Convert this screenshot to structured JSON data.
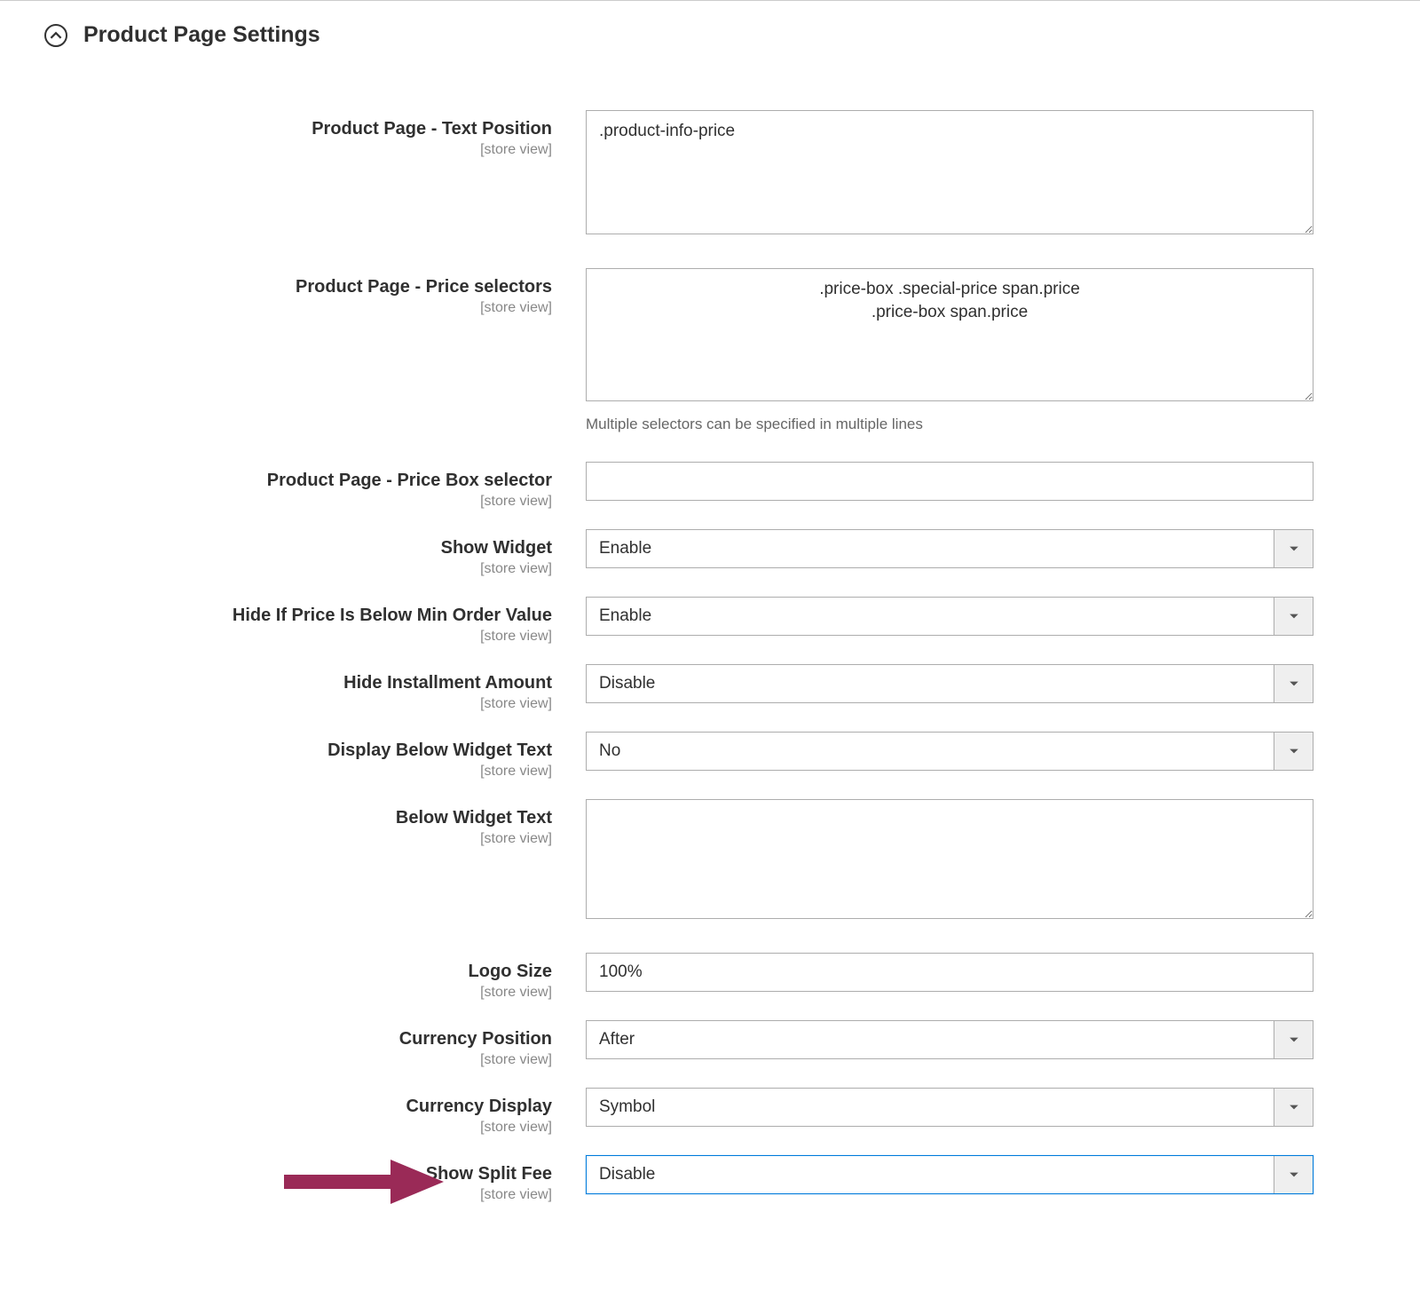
{
  "section": {
    "title": "Product Page Settings"
  },
  "fields": {
    "text_position": {
      "label": "Product Page - Text Position",
      "scope": "[store view]",
      "value": ".product-info-price"
    },
    "price_selectors": {
      "label": "Product Page - Price selectors",
      "scope": "[store view]",
      "value": ".price-box .special-price span.price\n.price-box span.price",
      "note": "Multiple selectors can be specified in multiple lines"
    },
    "price_box_selector": {
      "label": "Product Page - Price Box selector",
      "scope": "[store view]",
      "value": ""
    },
    "show_widget": {
      "label": "Show Widget",
      "scope": "[store view]",
      "value": "Enable"
    },
    "hide_below_min": {
      "label": "Hide If Price Is Below Min Order Value",
      "scope": "[store view]",
      "value": "Enable"
    },
    "hide_installment": {
      "label": "Hide Installment Amount",
      "scope": "[store view]",
      "value": "Disable"
    },
    "display_below_widget_text": {
      "label": "Display Below Widget Text",
      "scope": "[store view]",
      "value": "No"
    },
    "below_widget_text": {
      "label": "Below Widget Text",
      "scope": "[store view]",
      "value": ""
    },
    "logo_size": {
      "label": "Logo Size",
      "scope": "[store view]",
      "value": "100%"
    },
    "currency_position": {
      "label": "Currency Position",
      "scope": "[store view]",
      "value": "After"
    },
    "currency_display": {
      "label": "Currency Display",
      "scope": "[store view]",
      "value": "Symbol"
    },
    "show_split_fee": {
      "label": "Show Split Fee",
      "scope": "[store view]",
      "value": "Disable"
    }
  }
}
